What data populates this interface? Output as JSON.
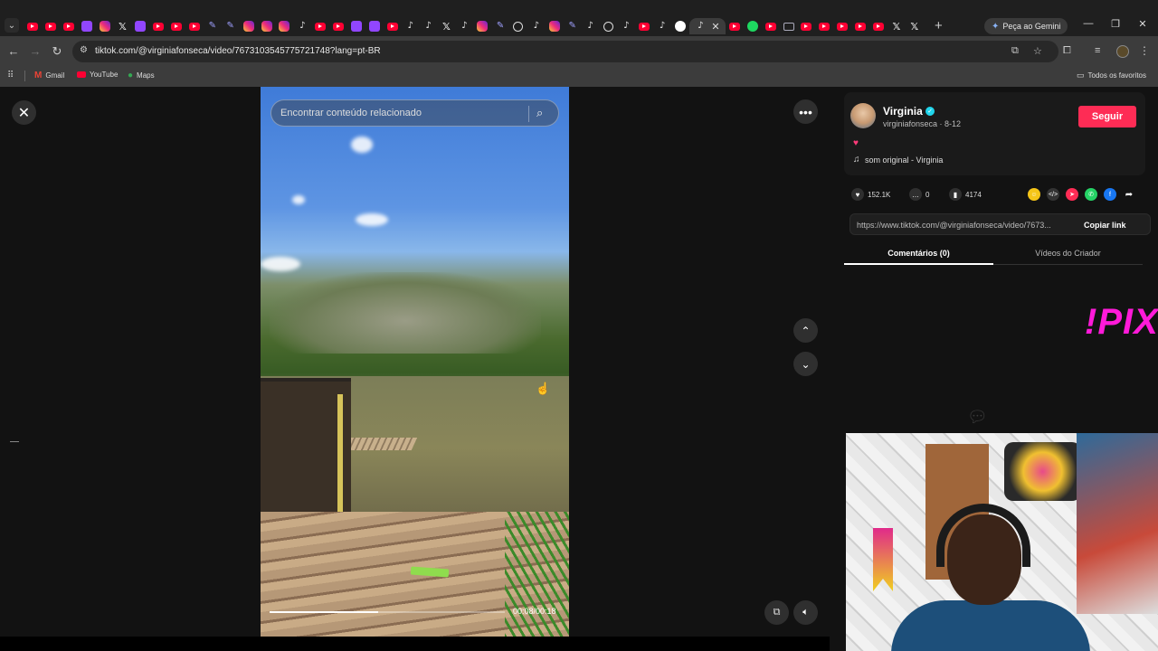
{
  "browser": {
    "tabs": [
      {
        "icon": "youtube-icon"
      },
      {
        "icon": "youtube-icon"
      },
      {
        "icon": "youtube-icon"
      },
      {
        "icon": "twitch-icon"
      },
      {
        "icon": "instagram-icon"
      },
      {
        "icon": "x-icon"
      },
      {
        "icon": "twitch-icon"
      },
      {
        "icon": "youtube-icon"
      },
      {
        "icon": "youtube-icon"
      },
      {
        "icon": "youtube-icon"
      },
      {
        "icon": "pen-icon"
      },
      {
        "icon": "pen-icon"
      },
      {
        "icon": "instagram-icon"
      },
      {
        "icon": "instagram-icon"
      },
      {
        "icon": "instagram-icon"
      },
      {
        "icon": "tiktok-icon"
      },
      {
        "icon": "youtube-icon"
      },
      {
        "icon": "youtube-icon"
      },
      {
        "icon": "twitch-icon"
      },
      {
        "icon": "twitch-icon"
      },
      {
        "icon": "youtube-icon"
      },
      {
        "icon": "tiktok-icon"
      },
      {
        "icon": "tiktok-icon"
      },
      {
        "icon": "x-icon"
      },
      {
        "icon": "tiktok-icon"
      },
      {
        "icon": "instagram-icon"
      },
      {
        "icon": "pen-icon"
      },
      {
        "icon": "github-icon"
      },
      {
        "icon": "tiktok-icon"
      },
      {
        "icon": "instagram-icon"
      },
      {
        "icon": "pen-icon"
      },
      {
        "icon": "tiktok-icon"
      },
      {
        "icon": "github-icon"
      },
      {
        "icon": "tiktok-icon"
      },
      {
        "icon": "youtube-icon"
      },
      {
        "icon": "tiktok-icon"
      },
      {
        "icon": "google-icon"
      },
      {
        "icon": "tiktok-icon",
        "active": true
      },
      {
        "icon": "youtube-icon"
      },
      {
        "icon": "spotify-icon"
      },
      {
        "icon": "youtube-icon"
      },
      {
        "icon": "mail-icon"
      },
      {
        "icon": "youtube-icon"
      },
      {
        "icon": "youtube-icon"
      },
      {
        "icon": "youtube-icon"
      },
      {
        "icon": "youtube-icon"
      },
      {
        "icon": "youtube-icon"
      },
      {
        "icon": "x-icon"
      },
      {
        "icon": "x-icon"
      }
    ],
    "gemini_label": "Peça ao Gemini",
    "url": "tiktok.com/@virginiafonseca/video/7673103545775721748?lang=pt-BR",
    "bookmarks": [
      {
        "label": "Gmail",
        "icon": "gmail-icon"
      },
      {
        "label": "YouTube",
        "icon": "youtube-icon"
      },
      {
        "label": "Maps",
        "icon": "maps-icon"
      }
    ],
    "all_bookmarks_label": "Todos os favoritos"
  },
  "viewer": {
    "search_placeholder": "Encontrar conteúdo relacionado",
    "time": "00:08/00:18",
    "progress": 0.46
  },
  "panel": {
    "creator_name": "Virginia",
    "creator_handle": "virginiafonseca · 8-12",
    "follow_label": "Seguir",
    "caption": "♥",
    "music": "som original - Virginia",
    "likes": "152.1K",
    "comments": "0",
    "saves": "4174",
    "link": "https://www.tiktok.com/@virginiafonseca/video/7673...",
    "copy_label": "Copiar link",
    "tab_comments": "Comentários (0)",
    "tab_creator": "Vídeos do Criador",
    "overlay_logo": "!PIX"
  },
  "colors": {
    "follow": "#fe2c55",
    "verified": "#20d5ec",
    "pix": "#ff1ad9"
  }
}
